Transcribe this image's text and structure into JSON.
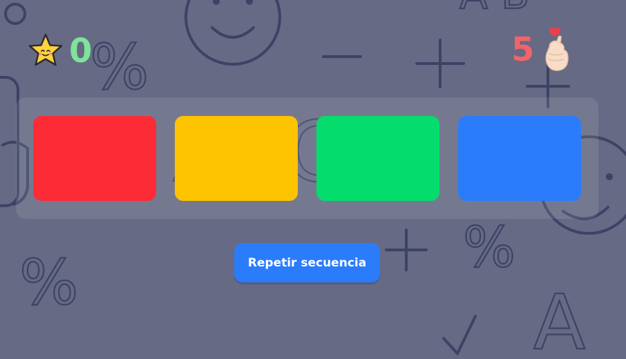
{
  "score": {
    "icon": "star-face-icon",
    "value": "0",
    "color": "#7ee39b"
  },
  "lives": {
    "value": "5",
    "icon": "finger-heart-icon",
    "color": "#f0646a"
  },
  "colors": {
    "red": "#fd2b36",
    "yellow": "#fec300",
    "green": "#04dd6d",
    "blue": "#2b7cfb",
    "background": "#666a84"
  },
  "tiles": [
    {
      "name": "red"
    },
    {
      "name": "yellow"
    },
    {
      "name": "green"
    },
    {
      "name": "blue"
    }
  ],
  "repeat_button": {
    "label": "Repetir secuencia"
  }
}
